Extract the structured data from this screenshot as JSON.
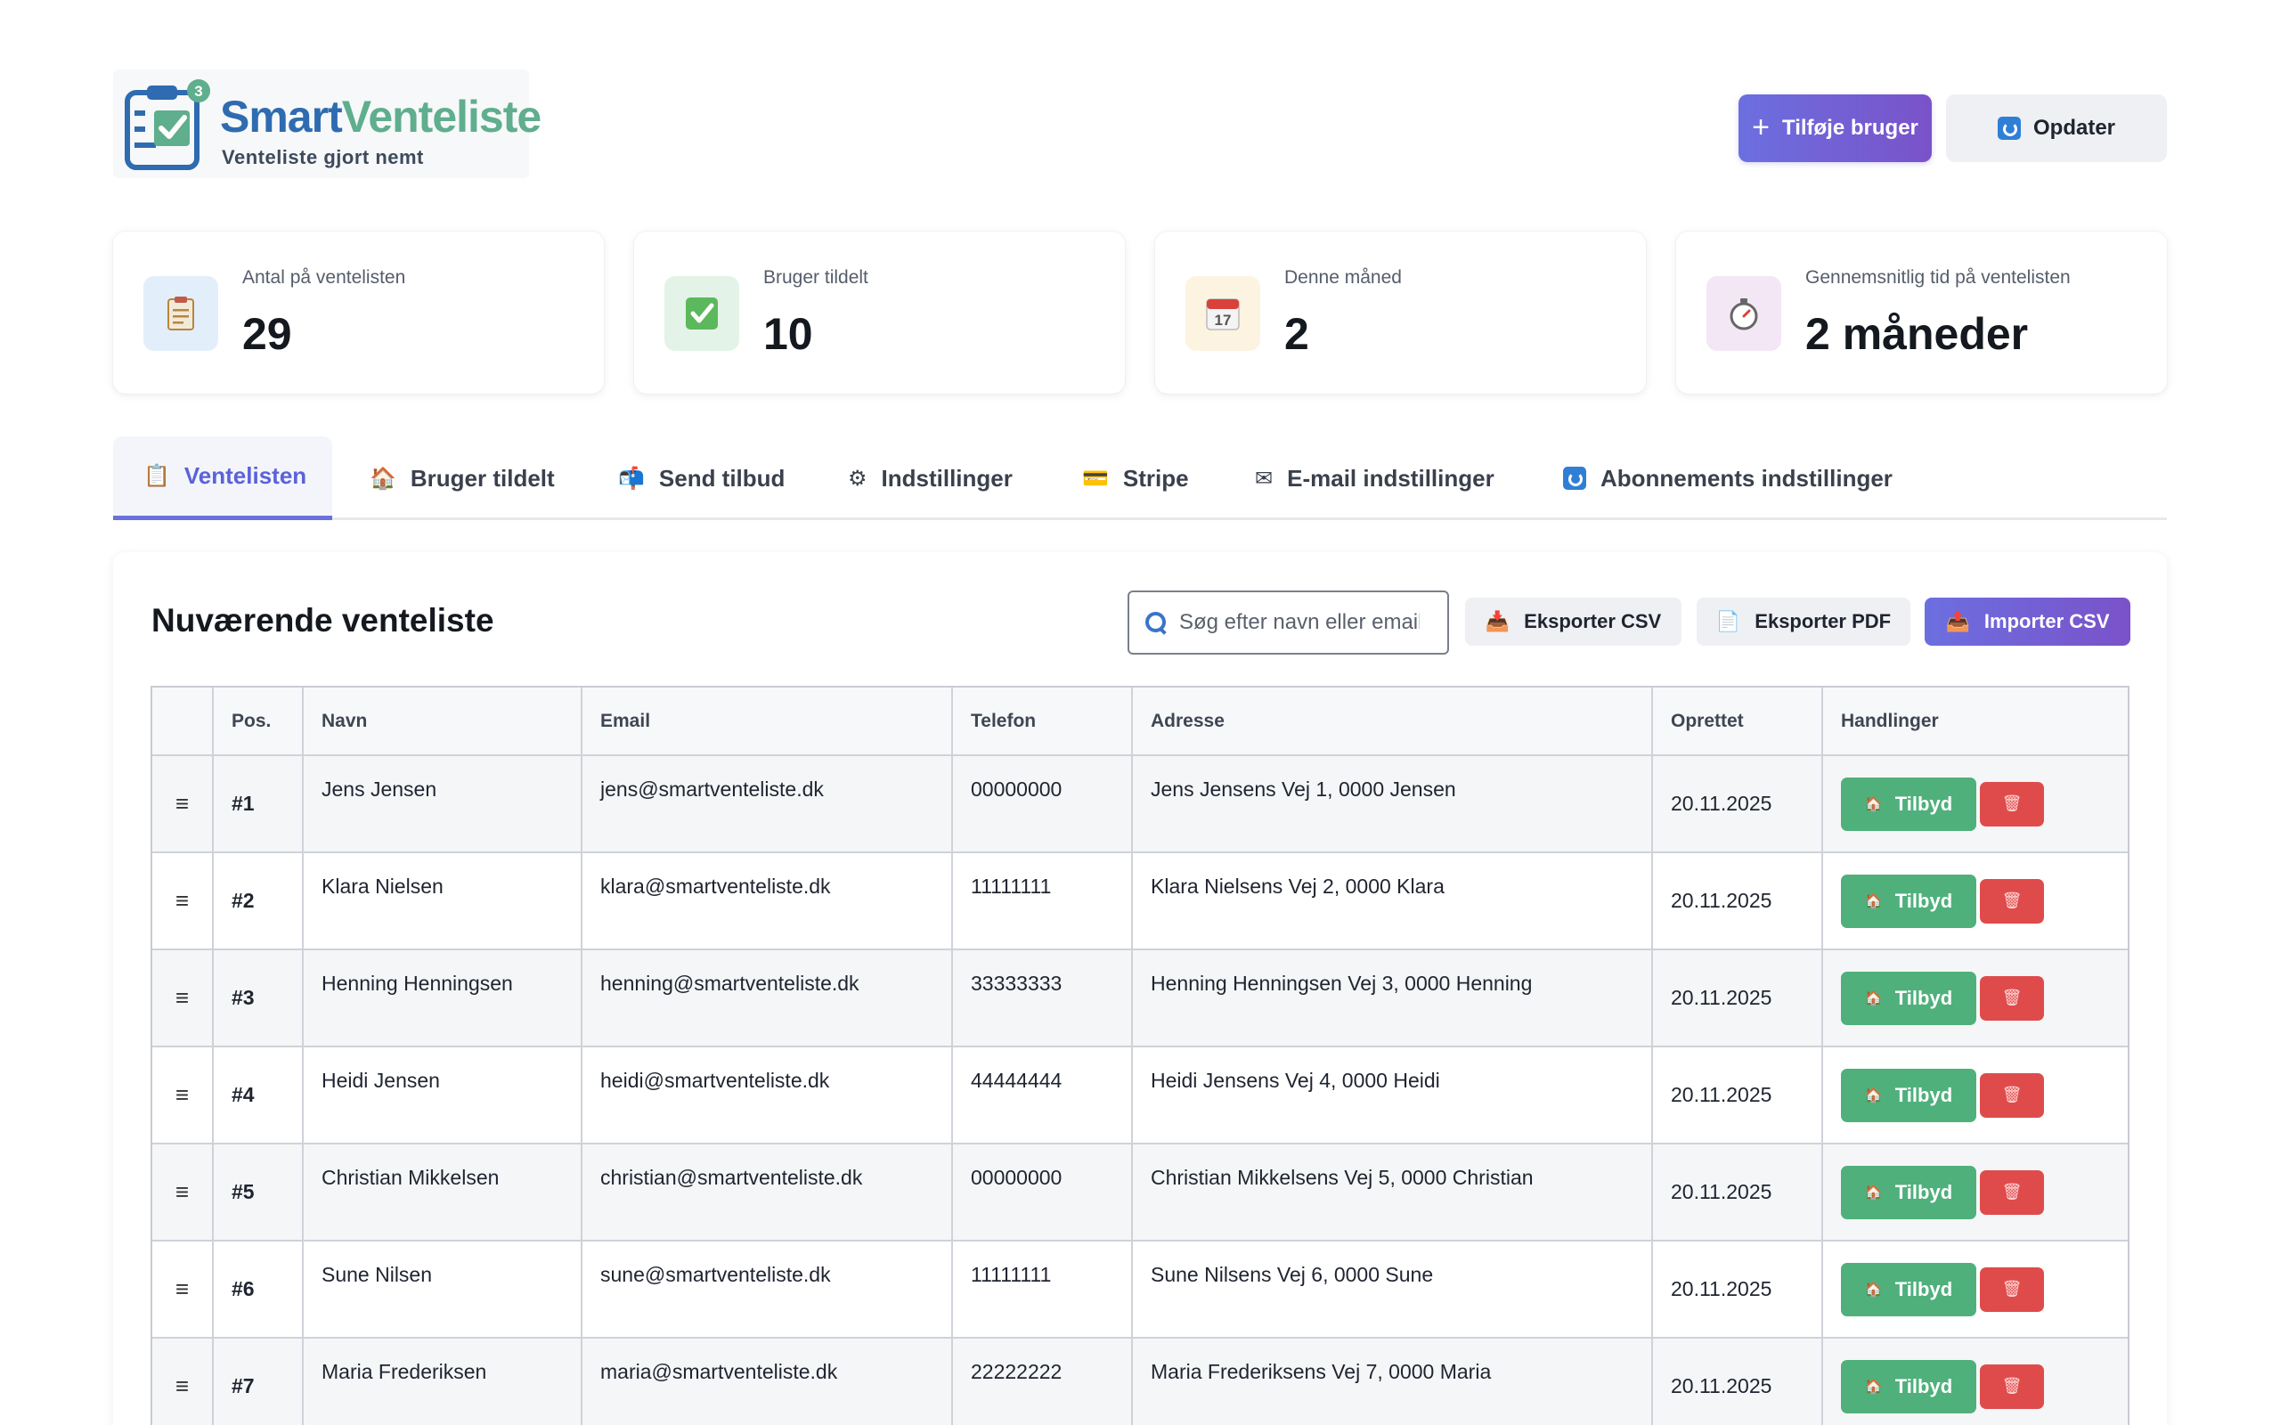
{
  "header": {
    "logo": {
      "title_a": "Smart",
      "title_b": "Venteliste",
      "subtitle": "Venteliste gjort nemt",
      "badge": "3"
    },
    "add_user_label": "Tilføje bruger",
    "refresh_label": "Opdater"
  },
  "stats": [
    {
      "label": "Antal på ventelisten",
      "value": "29",
      "icon": "clipboard-icon",
      "icon_bg": "#e2effb"
    },
    {
      "label": "Bruger tildelt",
      "value": "10",
      "icon": "check-box-icon",
      "icon_bg": "#e3f3e7"
    },
    {
      "label": "Denne måned",
      "value": "2",
      "icon": "calendar-icon",
      "icon_bg": "#fdf3e1"
    },
    {
      "label": "Gennemsnitlig tid på ventelisten",
      "value": "2 måneder",
      "icon": "stopwatch-icon",
      "icon_bg": "#f3e7f5"
    }
  ],
  "tabs": [
    {
      "label": "Ventelisten",
      "icon": "clipboard-icon",
      "active": true
    },
    {
      "label": "Bruger tildelt",
      "icon": "house-icon"
    },
    {
      "label": "Send tilbud",
      "icon": "mailbox-icon"
    },
    {
      "label": "Indstillinger",
      "icon": "gear-icon"
    },
    {
      "label": "Stripe",
      "icon": "credit-card-icon"
    },
    {
      "label": "E-mail indstillinger",
      "icon": "envelope-icon"
    },
    {
      "label": "Abonnements indstillinger",
      "icon": "refresh-icon"
    }
  ],
  "panel": {
    "title": "Nuværende venteliste",
    "search_placeholder": "Søg efter navn eller email",
    "export_csv": "Eksporter CSV",
    "export_pdf": "Eksporter PDF",
    "import_csv": "Importer CSV"
  },
  "table": {
    "columns": [
      "",
      "Pos.",
      "Navn",
      "Email",
      "Telefon",
      "Adresse",
      "Oprettet",
      "Handlinger"
    ],
    "offer_label": "Tilbyd",
    "rows": [
      {
        "pos": "#1",
        "name": "Jens Jensen",
        "email": "jens@smartventeliste.dk",
        "phone": "00000000",
        "address": "Jens Jensens Vej 1, 0000 Jensen",
        "created": "20.11.2025"
      },
      {
        "pos": "#2",
        "name": "Klara Nielsen",
        "email": "klara@smartventeliste.dk",
        "phone": "11111111",
        "address": "Klara Nielsens Vej 2, 0000 Klara",
        "created": "20.11.2025"
      },
      {
        "pos": "#3",
        "name": "Henning Henningsen",
        "email": "henning@smartventeliste.dk",
        "phone": "33333333",
        "address": "Henning Henningsen Vej 3, 0000 Henning",
        "created": "20.11.2025"
      },
      {
        "pos": "#4",
        "name": "Heidi Jensen",
        "email": "heidi@smartventeliste.dk",
        "phone": "44444444",
        "address": "Heidi Jensens Vej 4, 0000 Heidi",
        "created": "20.11.2025"
      },
      {
        "pos": "#5",
        "name": "Christian Mikkelsen",
        "email": "christian@smartventeliste.dk",
        "phone": "00000000",
        "address": "Christian Mikkelsens Vej 5, 0000 Christian",
        "created": "20.11.2025"
      },
      {
        "pos": "#6",
        "name": "Sune Nilsen",
        "email": "sune@smartventeliste.dk",
        "phone": "11111111",
        "address": "Sune Nilsens Vej 6, 0000 Sune",
        "created": "20.11.2025"
      },
      {
        "pos": "#7",
        "name": "Maria Frederiksen",
        "email": "maria@smartventeliste.dk",
        "phone": "22222222",
        "address": "Maria Frederiksens Vej 7, 0000 Maria",
        "created": "20.11.2025"
      }
    ]
  }
}
